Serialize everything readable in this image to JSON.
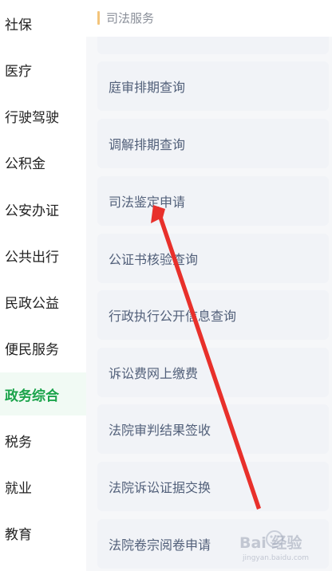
{
  "sidebar": {
    "items": [
      {
        "label": "社保"
      },
      {
        "label": "医疗"
      },
      {
        "label": "行驶驾驶"
      },
      {
        "label": "公积金"
      },
      {
        "label": "公安办证"
      },
      {
        "label": "公共出行"
      },
      {
        "label": "民政公益"
      },
      {
        "label": "便民服务"
      },
      {
        "label": "政务综合",
        "active": true
      },
      {
        "label": "税务"
      },
      {
        "label": "就业"
      },
      {
        "label": "教育"
      }
    ]
  },
  "content": {
    "section_title": "司法服务",
    "services": [
      {
        "label": "庭审排期查询"
      },
      {
        "label": "调解排期查询"
      },
      {
        "label": "司法鉴定申请"
      },
      {
        "label": "公证书核验查询"
      },
      {
        "label": "行政执行公开信息查询"
      },
      {
        "label": "诉讼费网上缴费"
      },
      {
        "label": "法院审判结果签收"
      },
      {
        "label": "法院诉讼证据交换"
      },
      {
        "label": "法院卷宗阅卷申请"
      }
    ]
  },
  "watermark": {
    "text": "Bai 经验",
    "sub": "jingyan.baidu.com"
  },
  "colors": {
    "accent_green": "#1aa34a",
    "arrow_red": "#e8302b",
    "section_bar": "#f3c47a"
  }
}
